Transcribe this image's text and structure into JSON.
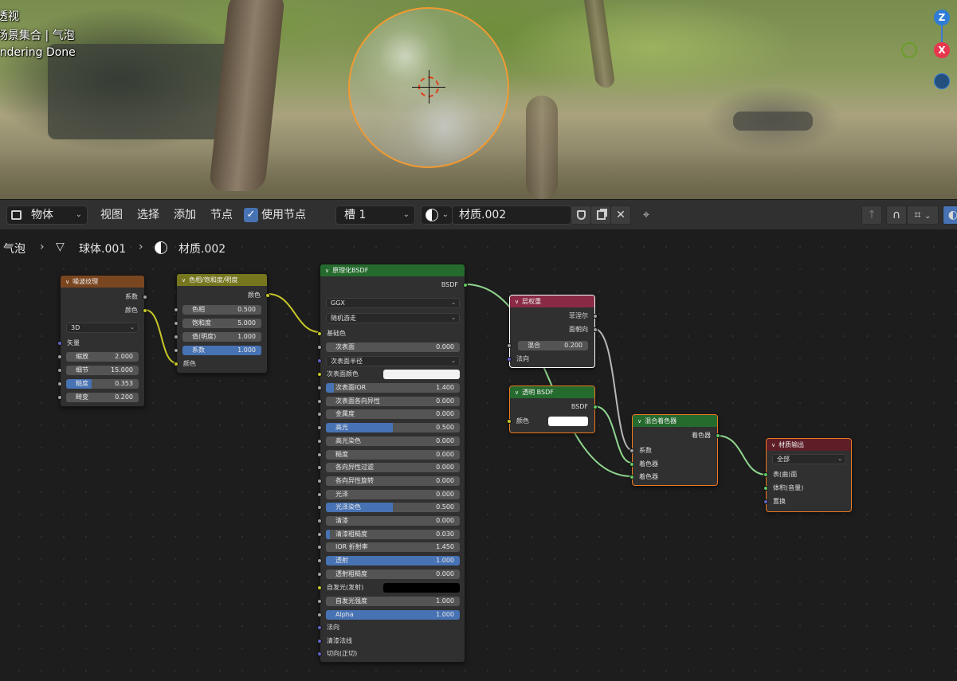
{
  "viewport": {
    "overlay_lines": [
      "透视",
      "场景集合 | 气泡",
      "Rendering Done"
    ],
    "gizmo": {
      "z": "Z",
      "x": "X"
    },
    "colors": {
      "selection": "#f19a32",
      "gizmo_x": "#e8374d",
      "gizmo_z": "#2e7cd6",
      "gizmo_y": "#6a9d2a"
    }
  },
  "header": {
    "editor_type_icon": "node-editor-icon",
    "object_mode": "物体",
    "menus": [
      "视图",
      "选择",
      "添加",
      "节点"
    ],
    "use_nodes_label": "使用节点",
    "use_nodes_checked": true,
    "slot": "槽 1",
    "material_name": "材质.002",
    "icons": [
      "shield-icon",
      "duplicate-icon",
      "close-icon",
      "pin-icon",
      "parent-node-icon",
      "snap-icon",
      "snap-settings-icon",
      "overlay-icon"
    ]
  },
  "breadcrumb": {
    "items": [
      "气泡",
      "球体.001",
      "材质.002"
    ],
    "icons": [
      "mesh-icon",
      "material-icon"
    ]
  },
  "nodes": {
    "noise": {
      "title": "噪波纹理",
      "header_color": "#7a4620",
      "outputs": [
        "系数",
        "颜色"
      ],
      "dimension": "3D",
      "vector_label": "矢量",
      "fields": [
        {
          "label": "缩放",
          "value": "2.000",
          "fraction": 0
        },
        {
          "label": "细节",
          "value": "15.000",
          "fraction": 0
        },
        {
          "label": "糙度",
          "value": "0.353",
          "fraction": 0.353
        },
        {
          "label": "畸变",
          "value": "0.200",
          "fraction": 0
        }
      ]
    },
    "hsv": {
      "title": "色相/饱和度/明度",
      "header_color": "#76761f",
      "output": "颜色",
      "fields": [
        {
          "label": "色相",
          "value": "0.500",
          "fraction": 0
        },
        {
          "label": "饱和度",
          "value": "5.000",
          "fraction": 0
        },
        {
          "label": "值(明度)",
          "value": "1.000",
          "fraction": 0
        },
        {
          "label": "系数",
          "value": "1.000",
          "fraction": 1
        }
      ],
      "input_color": "颜色"
    },
    "principled": {
      "title": "原理化BSDF",
      "header_color": "#256b2e",
      "output": "BSDF",
      "distribution": "GGX",
      "subsurface_method": "随机游走",
      "base_color_label": "基础色",
      "subsurface": {
        "label": "次表面",
        "value": "0.000"
      },
      "subsurface_radius": "次表面半径",
      "subsurface_color": "次表面颜色",
      "fields": [
        {
          "label": "次表面IOR",
          "value": "1.400",
          "fraction": 0.06
        },
        {
          "label": "次表面各向异性",
          "value": "0.000",
          "fraction": 0
        },
        {
          "label": "金属度",
          "value": "0.000",
          "fraction": 0
        },
        {
          "label": "高光",
          "value": "0.500",
          "fraction": 0.5
        },
        {
          "label": "高光染色",
          "value": "0.000",
          "fraction": 0
        },
        {
          "label": "糙度",
          "value": "0.000",
          "fraction": 0
        },
        {
          "label": "各向异性过滤",
          "value": "0.000",
          "fraction": 0
        },
        {
          "label": "各向异性旋转",
          "value": "0.000",
          "fraction": 0
        },
        {
          "label": "光泽",
          "value": "0.000",
          "fraction": 0
        },
        {
          "label": "光泽染色",
          "value": "0.500",
          "fraction": 0.5
        },
        {
          "label": "清漆",
          "value": "0.000",
          "fraction": 0
        },
        {
          "label": "清漆粗糙度",
          "value": "0.030",
          "fraction": 0.03
        },
        {
          "label": "IOR 折射率",
          "value": "1.450",
          "fraction": 0
        },
        {
          "label": "透射",
          "value": "1.000",
          "fraction": 1
        },
        {
          "label": "透射粗糙度",
          "value": "0.000",
          "fraction": 0
        }
      ],
      "emission": "自发光(发射)",
      "emission_strength": {
        "label": "自发光强度",
        "value": "1.000"
      },
      "alpha": {
        "label": "Alpha",
        "value": "1.000",
        "fraction": 1
      },
      "vector_inputs": [
        "法向",
        "清漆法线",
        "切向(正切)"
      ]
    },
    "layer_weight": {
      "title": "层权重",
      "header_color": "#8a2a45",
      "outputs": [
        "菲涅尔",
        "面朝向"
      ],
      "blend": {
        "label": "混合",
        "value": "0.200"
      },
      "normal": "法向"
    },
    "transparent": {
      "title": "透明 BSDF",
      "header_color": "#256b2e",
      "output": "BSDF",
      "color_label": "颜色"
    },
    "mix_shader": {
      "title": "混合着色器",
      "header_color": "#256b2e",
      "output": "着色器",
      "inputs": [
        "系数",
        "着色器",
        "着色器"
      ]
    },
    "output": {
      "title": "材质输出",
      "header_color": "#5e1e28",
      "target": "全部",
      "inputs": [
        "表(曲)面",
        "体积(音量)",
        "置换"
      ]
    }
  }
}
